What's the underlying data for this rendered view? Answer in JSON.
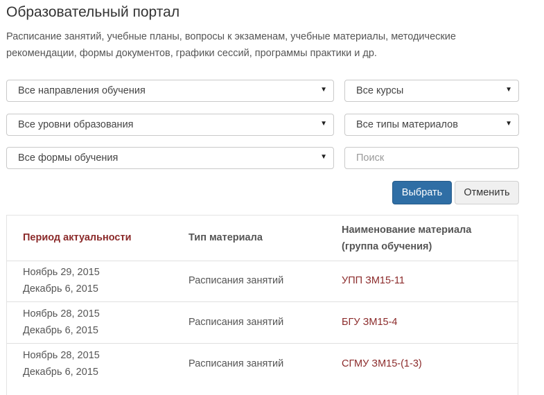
{
  "header": {
    "title": "Образовательный портал",
    "description": "Расписание занятий, учебные планы, вопросы к экзаменам, учебные материалы, методические рекомендации, формы документов, графики сессий, программы практики и др."
  },
  "filters": {
    "direction": "Все направления обучения",
    "course": "Все курсы",
    "level": "Все уровни образования",
    "material_type": "Все типы материалов",
    "study_form": "Все формы обучения",
    "search_placeholder": "Поиск"
  },
  "buttons": {
    "select": "Выбрать",
    "cancel": "Отменить"
  },
  "table": {
    "headers": {
      "period": "Период актуальности",
      "type": "Тип материала",
      "name_line1": "Наименование материала",
      "name_line2": "(группа обучения)"
    },
    "rows": [
      {
        "date_from": "Ноябрь 29, 2015",
        "date_to": "Декабрь 6, 2015",
        "type": "Расписания занятий",
        "name": "УПП ЗМ15-11"
      },
      {
        "date_from": "Ноябрь 28, 2015",
        "date_to": "Декабрь 6, 2015",
        "type": "Расписания занятий",
        "name": "БГУ ЗМ15-4"
      },
      {
        "date_from": "Ноябрь 28, 2015",
        "date_to": "Декабрь 6, 2015",
        "type": "Расписания занятий",
        "name": "СГМУ ЗМ15-(1-3)"
      }
    ]
  },
  "colors": {
    "primary_button": "#2f6ea5",
    "accent_text": "#8b2a2a"
  }
}
